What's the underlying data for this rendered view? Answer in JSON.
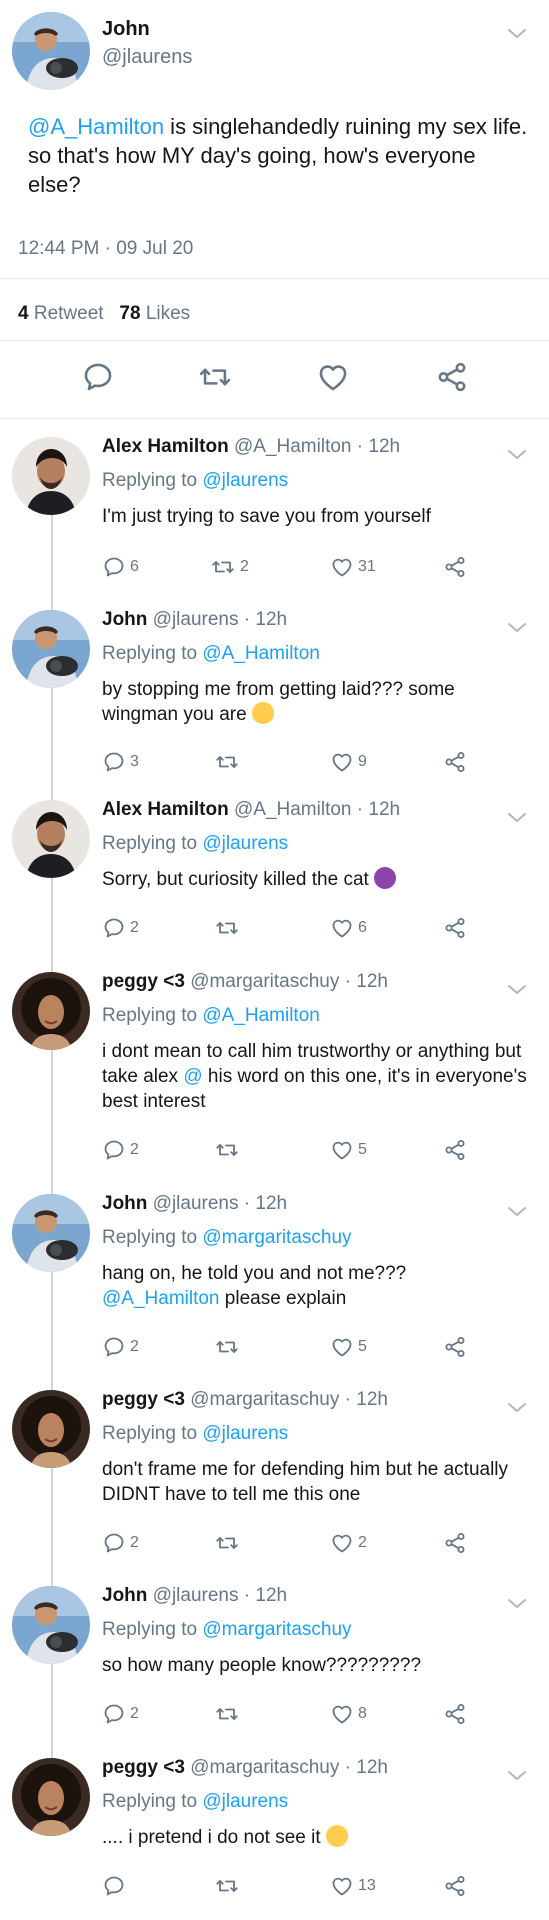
{
  "main_tweet": {
    "name": "John",
    "handle": "@jlaurens",
    "mention": "@A_Hamilton",
    "text_rest": " is singlehandedly ruining my sex life. so that's how MY day's going, how's everyone else?",
    "timestamp": "12:44 PM · 09 Jul 20",
    "retweets": "4",
    "retweets_label": "Retweet",
    "likes": "78",
    "likes_label": "Likes"
  },
  "replies": [
    {
      "name": "Alex Hamilton",
      "handle": "@A_Hamilton",
      "time": "· 12h",
      "replying_prefix": "Replying to",
      "replying_to": "@jlaurens",
      "text": "I'm just trying to save you from yourself",
      "replies": "6",
      "retweets": "2",
      "likes": "31"
    },
    {
      "name": "John",
      "handle": "@jlaurens",
      "time": "· 12h",
      "replying_prefix": "Replying to",
      "replying_to": "@A_Hamilton",
      "text": "by stopping me from getting laid??? some wingman you are",
      "replies": "3",
      "retweets": "",
      "likes": "9"
    },
    {
      "name": "Alex Hamilton",
      "handle": "@A_Hamilton",
      "time": "· 12h",
      "replying_prefix": "Replying to",
      "replying_to": "@jlaurens",
      "text": "Sorry, but curiosity killed the cat",
      "replies": "2",
      "retweets": "",
      "likes": "6"
    },
    {
      "name": "peggy <3",
      "handle": "@margaritaschuy",
      "time": "· 12h",
      "replying_prefix": "Replying to",
      "replying_to": "@A_Hamilton",
      "text_a": "i dont mean to call him trustworthy or anything but take alex ",
      "text_link": "@",
      "text_b": " his word on this one, it's in everyone's best interest",
      "replies": "2",
      "retweets": "",
      "likes": "5"
    },
    {
      "name": "John",
      "handle": "@jlaurens",
      "time": "· 12h",
      "replying_prefix": "Replying to",
      "replying_to": "@margaritaschuy",
      "text_a": "hang on, he told you and not me???",
      "text_link": "@A_Hamilton",
      "text_b": " please explain",
      "replies": "2",
      "retweets": "",
      "likes": "5"
    },
    {
      "name": "peggy <3",
      "handle": "@margaritaschuy",
      "time": "· 12h",
      "replying_prefix": "Replying to",
      "replying_to": "@jlaurens",
      "text": "don't frame me for defending him but he actually DIDNT have to tell me this one",
      "replies": "2",
      "retweets": "",
      "likes": "2"
    },
    {
      "name": "John",
      "handle": "@jlaurens",
      "time": "· 12h",
      "replying_prefix": "Replying to",
      "replying_to": "@margaritaschuy",
      "text": "so how many people know?????????",
      "replies": "2",
      "retweets": "",
      "likes": "8"
    },
    {
      "name": "peggy <3",
      "handle": "@margaritaschuy",
      "time": "· 12h",
      "replying_prefix": "Replying to",
      "replying_to": "@jlaurens",
      "text": ".... i pretend i do not see it",
      "replies": "",
      "retweets": "",
      "likes": "13"
    }
  ],
  "icons": {
    "reply": "reply-icon",
    "retweet": "retweet-icon",
    "like": "heart-icon",
    "share": "share-icon",
    "more": "chevron-down-icon"
  },
  "colors": {
    "link": "#1da1f2",
    "muted": "#657786",
    "text": "#14171a",
    "divider": "#e1e8ed"
  }
}
